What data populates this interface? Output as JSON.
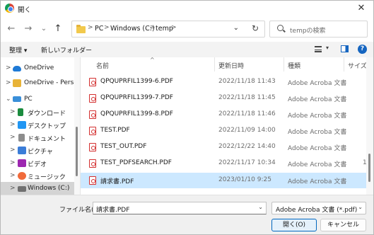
{
  "window": {
    "title": "開く",
    "close_glyph": "✕"
  },
  "nav": {
    "back": "←",
    "forward": "→",
    "dropdown": "⌄",
    "up": "↑"
  },
  "address": {
    "crumbs": [
      "PC",
      "Windows (C:)",
      "temp"
    ],
    "separator": ">",
    "dropdown": "⌄",
    "refresh": "↻"
  },
  "search": {
    "placeholder": "tempの検索"
  },
  "toolbar": {
    "organize": "整理 ▾",
    "new_folder": "新しいフォルダー",
    "view_dropdown": "▾",
    "help": "?"
  },
  "sidebar": {
    "items": [
      {
        "label": "OneDrive",
        "chevron": ">",
        "icon": "onedrive-cloud-icon"
      },
      {
        "label": "OneDrive - Persor",
        "chevron": ">",
        "icon": "onedrive-folder-icon"
      },
      {
        "label": "PC",
        "chevron": "⌄",
        "icon": "pc-icon"
      },
      {
        "label": "ダウンロード",
        "chevron": ">",
        "icon": "download-icon"
      },
      {
        "label": "デスクトップ",
        "chevron": ">",
        "icon": "desktop-icon"
      },
      {
        "label": "ドキュメント",
        "chevron": ">",
        "icon": "document-icon"
      },
      {
        "label": "ピクチャ",
        "chevron": ">",
        "icon": "pictures-icon"
      },
      {
        "label": "ビデオ",
        "chevron": ">",
        "icon": "video-icon"
      },
      {
        "label": "ミュージック",
        "chevron": ">",
        "icon": "music-icon"
      },
      {
        "label": "Windows (C:)",
        "chevron": ">",
        "icon": "drive-icon"
      }
    ]
  },
  "columns": {
    "name": "名前",
    "date": "更新日時",
    "type": "種類",
    "size": "サイズ",
    "sort_arrow": "^"
  },
  "files": [
    {
      "name": "QPQUPRFIL1399-6.PDF",
      "date": "2022/11/18 11:43",
      "type": "Adobe Acroba 文書",
      "size": ""
    },
    {
      "name": "QPQUPRFIL1399-7.PDF",
      "date": "2022/11/18 11:45",
      "type": "Adobe Acroba 文書",
      "size": ""
    },
    {
      "name": "QPQUPRFIL1399-8.PDF",
      "date": "2022/11/18 11:46",
      "type": "Adobe Acroba 文書",
      "size": ""
    },
    {
      "name": "TEST.PDF",
      "date": "2022/11/09 14:00",
      "type": "Adobe Acroba 文書",
      "size": ""
    },
    {
      "name": "TEST_OUT.PDF",
      "date": "2022/12/22 14:40",
      "type": "Adobe Acroba 文書",
      "size": ""
    },
    {
      "name": "TEST_PDFSEARCH.PDF",
      "date": "2022/11/17 10:34",
      "type": "Adobe Acroba 文書",
      "size": "1"
    },
    {
      "name": "請求書.PDF",
      "date": "2023/01/10 9:25",
      "type": "Adobe Acroba 文書",
      "size": ""
    }
  ],
  "bottom": {
    "filename_label": "ファイル名(N):",
    "filename_value": "請求書.PDF",
    "filetype_value": "Adobe Acroba 文書 (*.pdf)",
    "dropdown": "⌄",
    "open_button": "開く(O)",
    "cancel_button": "キャンセル"
  }
}
